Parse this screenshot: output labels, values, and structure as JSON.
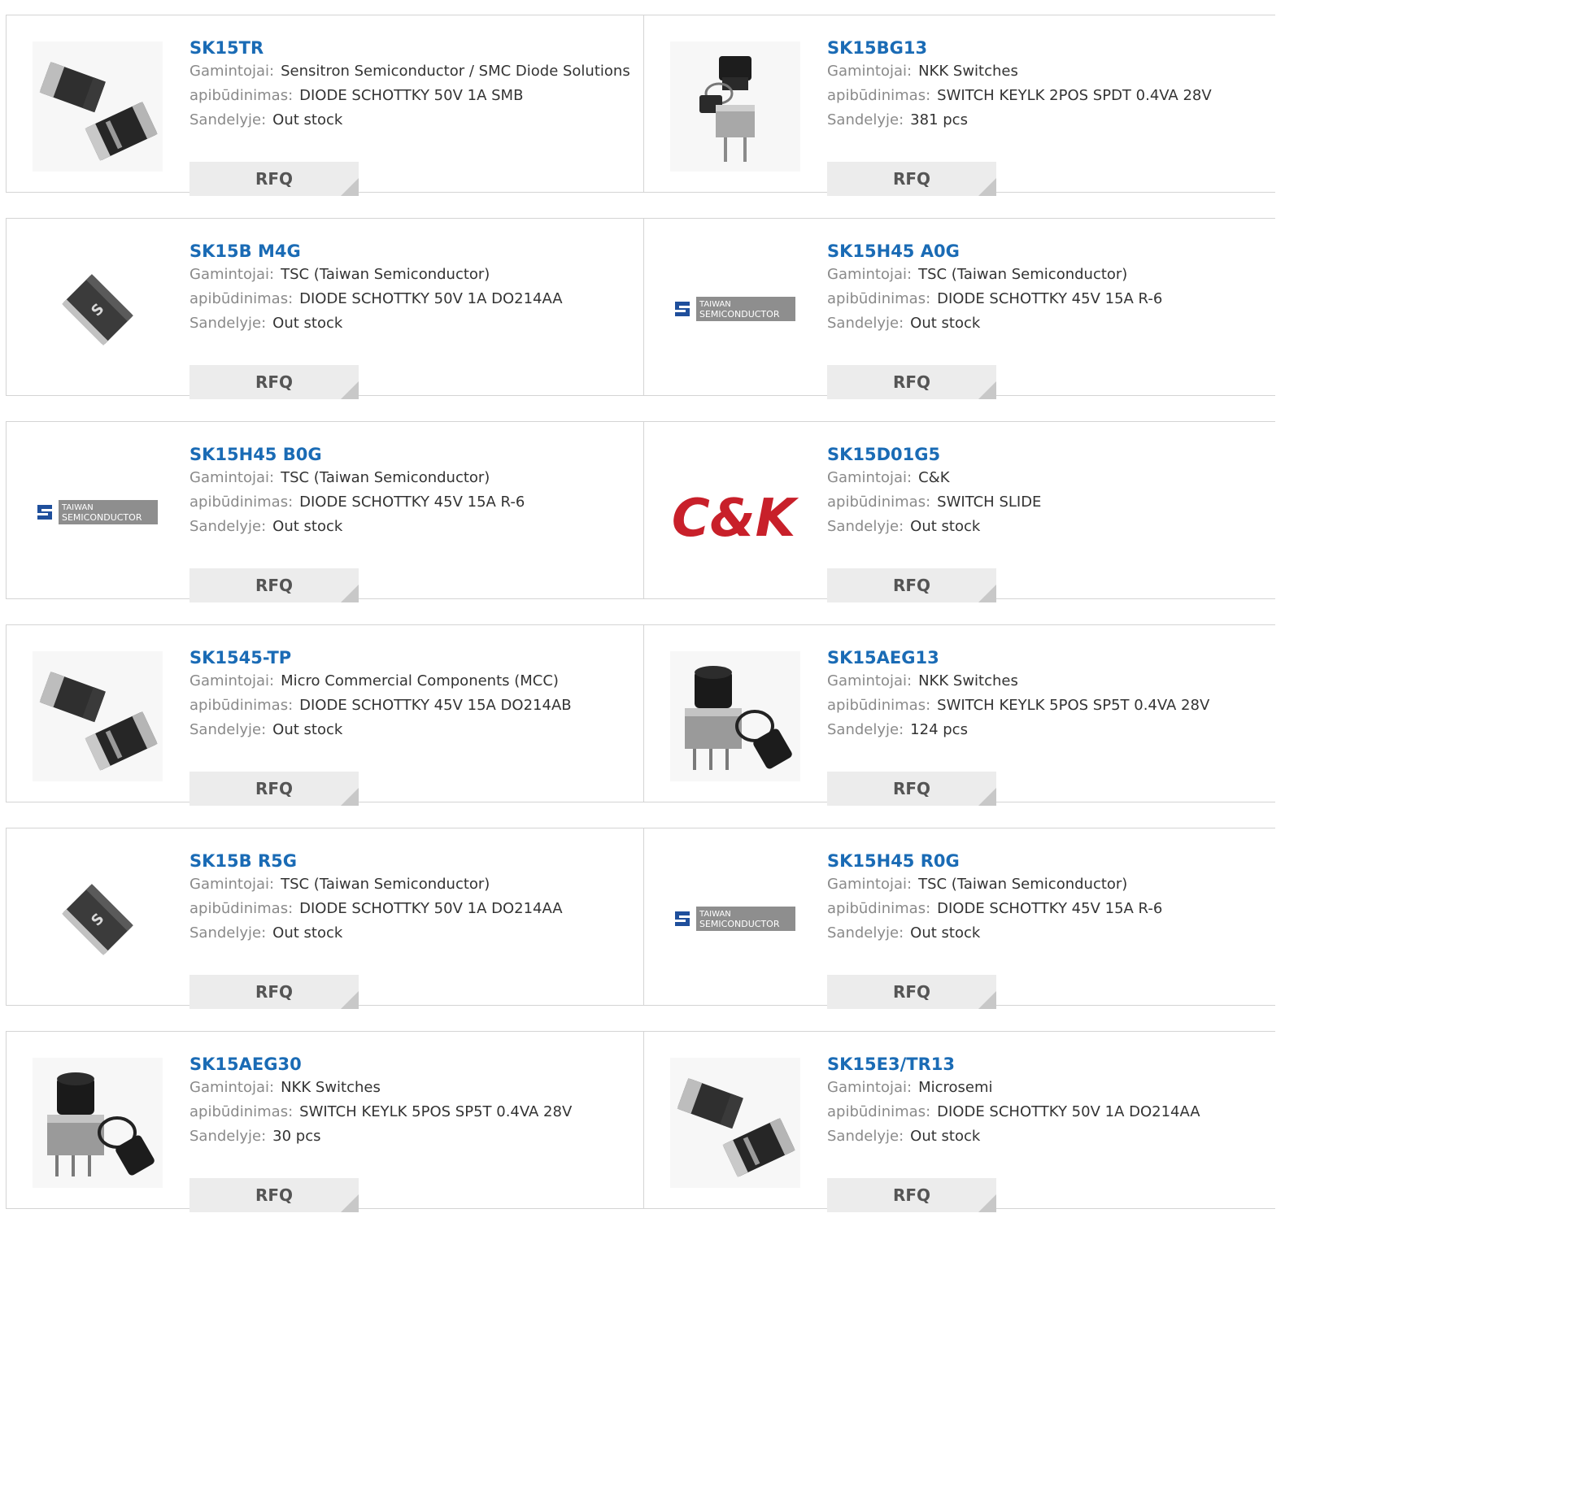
{
  "labels": {
    "manufacturer": "Gamintojai:",
    "description": "apibūdinimas:",
    "stock": "Sandelyje:",
    "rfq": "RFQ"
  },
  "products": [
    {
      "pn": "SK15TR",
      "manufacturer": "Sensitron Semiconductor / SMC Diode Solutions",
      "description": "DIODE SCHOTTKY 50V 1A SMB",
      "stock": "Out stock",
      "image": "smb-diode-pair"
    },
    {
      "pn": "SK15BG13",
      "manufacturer": "NKK Switches",
      "description": "SWITCH KEYLK 2POS SPDT 0.4VA 28V",
      "stock": "381 pcs",
      "image": "keylock-switch"
    },
    {
      "pn": "SK15B M4G",
      "manufacturer": "TSC (Taiwan Semiconductor)",
      "description": "DIODE SCHOTTKY 50V 1A DO214AA",
      "stock": "Out stock",
      "image": "tsc-smd-chip"
    },
    {
      "pn": "SK15H45 A0G",
      "manufacturer": "TSC (Taiwan Semiconductor)",
      "description": "DIODE SCHOTTKY 45V 15A R-6",
      "stock": "Out stock",
      "image": "taiwan-semiconductor-logo"
    },
    {
      "pn": "SK15H45 B0G",
      "manufacturer": "TSC (Taiwan Semiconductor)",
      "description": "DIODE SCHOTTKY 45V 15A R-6",
      "stock": "Out stock",
      "image": "taiwan-semiconductor-logo"
    },
    {
      "pn": "SK15D01G5",
      "manufacturer": "C&K",
      "description": "SWITCH SLIDE",
      "stock": "Out stock",
      "image": "ck-logo"
    },
    {
      "pn": "SK1545-TP",
      "manufacturer": "Micro Commercial Components (MCC)",
      "description": "DIODE SCHOTTKY 45V 15A DO214AB",
      "stock": "Out stock",
      "image": "smb-diode-pair"
    },
    {
      "pn": "SK15AEG13",
      "manufacturer": "NKK Switches",
      "description": "SWITCH KEYLK 5POS SP5T 0.4VA 28V",
      "stock": "124 pcs",
      "image": "keylock-switch-tagged"
    },
    {
      "pn": "SK15B R5G",
      "manufacturer": "TSC (Taiwan Semiconductor)",
      "description": "DIODE SCHOTTKY 50V 1A DO214AA",
      "stock": "Out stock",
      "image": "tsc-smd-chip"
    },
    {
      "pn": "SK15H45 R0G",
      "manufacturer": "TSC (Taiwan Semiconductor)",
      "description": "DIODE SCHOTTKY 45V 15A R-6",
      "stock": "Out stock",
      "image": "taiwan-semiconductor-logo"
    },
    {
      "pn": "SK15AEG30",
      "manufacturer": "NKK Switches",
      "description": "SWITCH KEYLK 5POS SP5T 0.4VA 28V",
      "stock": "30 pcs",
      "image": "keylock-switch-tagged"
    },
    {
      "pn": "SK15E3/TR13",
      "manufacturer": "Microsemi",
      "description": "DIODE SCHOTTKY 50V 1A DO214AA",
      "stock": "Out stock",
      "image": "smb-diode-pair"
    }
  ],
  "logo_text": {
    "tsc_line1": "TAIWAN",
    "tsc_line2": "SEMICONDUCTOR",
    "ck": "C&K"
  },
  "colors": {
    "link": "#1a6bb5",
    "label": "#8a8a8a",
    "value": "#333333",
    "rfq_bg": "#ececec",
    "ck_red": "#c8202a"
  }
}
